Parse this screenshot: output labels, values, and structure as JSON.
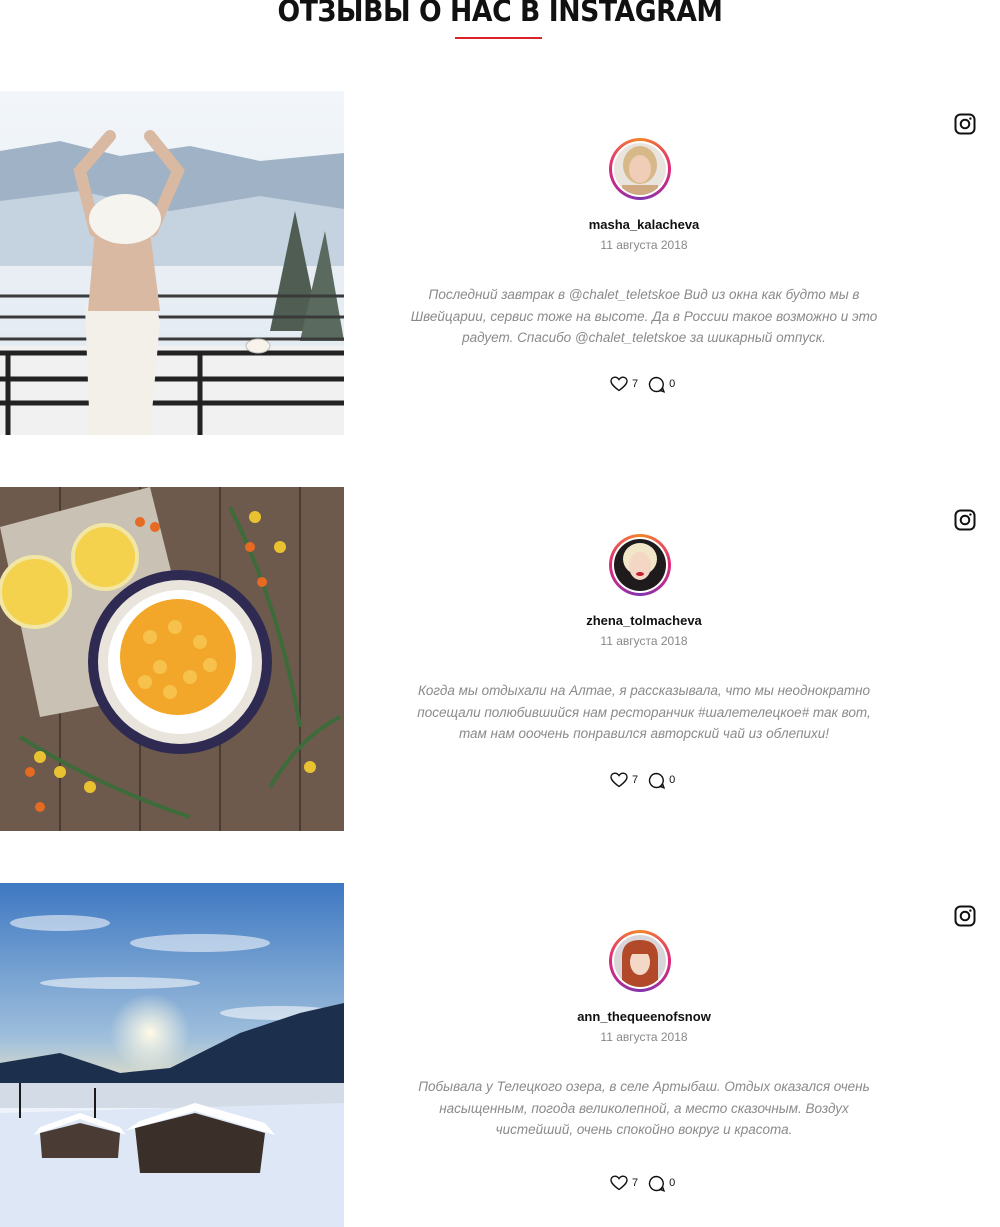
{
  "section": {
    "title": "ОТЗЫВЫ О НАС В INSTAGRAM",
    "accent_color": "#d9232a"
  },
  "reviews": [
    {
      "username": "masha_kalacheva",
      "date": "11 августа 2018",
      "text": "Последний завтрак в @chalet_teletskoe Вид из окна как будто мы в Швейцарии, сервис тоже на высоте. Да в России такое возможно и это радует. Спасибо @chalet_teletskoe за шикарный отпуск.",
      "likes": "7",
      "comments": "0",
      "photo": "woman-in-towel-on-balcony-photo",
      "avatar": "blonde-woman-avatar"
    },
    {
      "username": "zhena_tolmacheva",
      "date": "11 августа 2018",
      "text": "Когда мы отдыхали на Алтае, я рассказывала, что мы неоднократно посещали полюбившийся нам ресторанчик #шалетелецкое# так вот, там нам ооочень понравился авторский чай из облепихи!",
      "likes": "7",
      "comments": "0",
      "photo": "sea-buckthorn-tea-photo",
      "avatar": "platinum-blonde-woman-avatar"
    },
    {
      "username": "ann_thequeenofsnow",
      "date": "11 августа 2018",
      "text": "Побывала у Телецкого озера, в селе Артыбаш. Отдых оказался очень насыщенным, погода великолепной, а место сказочным. Воздух чистейший, очень спокойно вокруг и красота.",
      "likes": "7",
      "comments": "0",
      "photo": "winter-lake-sunset-photo",
      "avatar": "redhead-woman-avatar"
    }
  ]
}
